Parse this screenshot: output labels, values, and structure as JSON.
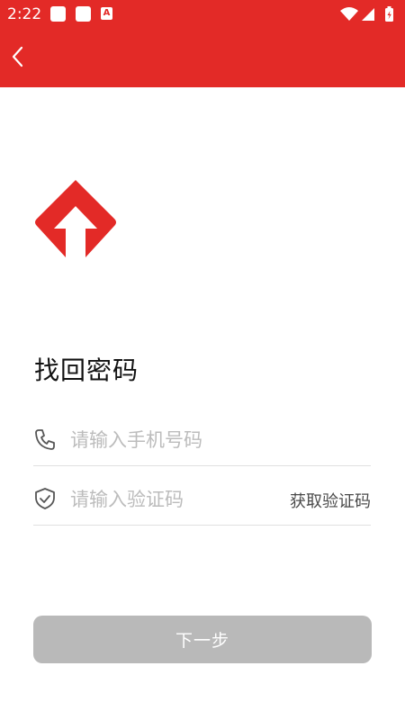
{
  "status_bar": {
    "time": "2:22",
    "notification_icons": [
      "square-notification-icon",
      "square-notification-icon",
      "a-app-icon"
    ],
    "right_icons": [
      "wifi-icon",
      "signal-icon",
      "battery-charging-icon"
    ]
  },
  "app_bar": {
    "color": "#e32a27",
    "back_icon": "chevron-left-icon"
  },
  "logo": {
    "icon": "up-arrow-diamond-logo",
    "color": "#e32a27"
  },
  "title": "找回密码",
  "phone_field": {
    "icon": "phone-icon",
    "placeholder": "请输入手机号码",
    "value": ""
  },
  "code_field": {
    "icon": "shield-check-icon",
    "placeholder": "请输入验证码",
    "value": "",
    "get_code_label": "获取验证码"
  },
  "next_button": {
    "label": "下一步",
    "state": "disabled",
    "color": "#b9b9b9"
  }
}
